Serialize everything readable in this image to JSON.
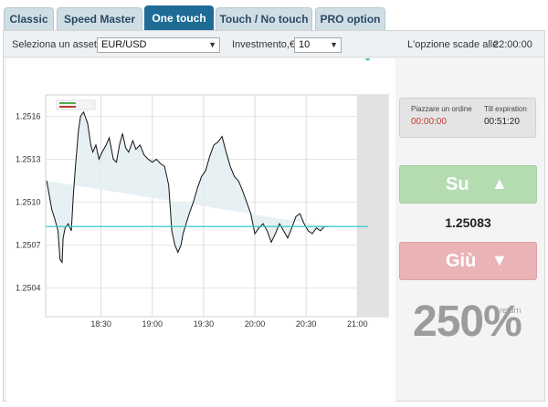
{
  "tabs": [
    {
      "label": "Classic",
      "active": false
    },
    {
      "label": "Speed Master",
      "active": false
    },
    {
      "label": "One touch",
      "active": true
    },
    {
      "label": "Touch / No touch",
      "active": false
    },
    {
      "label": "PRO option",
      "active": false
    }
  ],
  "toolbar": {
    "asset_label": "Seleziona un asset",
    "asset_value": "EUR/USD",
    "investment_label": "Investmento,€",
    "investment_value": "10",
    "expiry_label": "L'opzione scade alle",
    "expiry_time": "22:00:00"
  },
  "order": {
    "place_label": "Piazzare un ordine",
    "place_time": "00:00:00",
    "till_label": "Till expiration",
    "till_time": "00:51:20"
  },
  "buttons": {
    "up_label": "Su",
    "down_label": "Giù"
  },
  "current_price": "1.25083",
  "return_value": "250%",
  "return_label": "return",
  "colors": {
    "active_tab": "#1e6b96",
    "up": "#b5dcb1",
    "down": "#eab4b6",
    "order_time": "#c0392b",
    "price_line": "#3ec7c7",
    "area_fill": "#e3eff2"
  },
  "chart_data": {
    "type": "area",
    "x_ticks": [
      "18:30",
      "19:00",
      "19:30",
      "20:00",
      "20:30",
      "21:00"
    ],
    "y_ticks": [
      "1.2504",
      "1.2507",
      "1.2510",
      "1.2513",
      "1.2516"
    ],
    "ylim": [
      1.2502,
      1.25175
    ],
    "xlim": [
      17.96,
      21.3
    ],
    "grid": true,
    "reference_line": 1.25083,
    "expiry_zone_start": 21.0,
    "x": [
      17.97,
      18.02,
      18.05,
      18.08,
      18.1,
      18.12,
      18.13,
      18.15,
      18.18,
      18.21,
      18.23,
      18.25,
      18.28,
      18.3,
      18.33,
      18.37,
      18.4,
      18.42,
      18.45,
      18.48,
      18.51,
      18.55,
      18.58,
      18.62,
      18.65,
      18.68,
      18.71,
      18.74,
      18.77,
      18.81,
      18.84,
      18.88,
      18.92,
      18.96,
      19.0,
      19.04,
      19.08,
      19.12,
      19.16,
      19.19,
      19.22,
      19.25,
      19.28,
      19.3,
      19.33,
      19.36,
      19.4,
      19.44,
      19.48,
      19.52,
      19.56,
      19.6,
      19.64,
      19.68,
      19.72,
      19.76,
      19.8,
      19.84,
      19.88,
      19.92,
      19.96,
      20.0,
      20.04,
      20.08,
      20.12,
      20.16,
      20.2,
      20.24,
      20.28,
      20.32,
      20.36,
      20.4,
      20.44,
      20.48,
      20.52,
      20.56,
      20.6,
      20.64,
      20.68,
      20.72,
      20.76,
      20.8,
      20.84,
      20.88,
      20.92,
      20.96,
      20.99,
      21.03,
      21.07,
      21.1
    ],
    "y": [
      1.25115,
      1.25095,
      1.25088,
      1.2508,
      1.2506,
      1.25058,
      1.25075,
      1.25082,
      1.25085,
      1.2508,
      1.25105,
      1.25125,
      1.2515,
      1.2516,
      1.25163,
      1.25155,
      1.2514,
      1.25135,
      1.2514,
      1.2513,
      1.25135,
      1.2514,
      1.25145,
      1.2513,
      1.25128,
      1.2514,
      1.25148,
      1.25138,
      1.25135,
      1.25143,
      1.25137,
      1.2514,
      1.25133,
      1.2513,
      1.25128,
      1.2513,
      1.25127,
      1.25125,
      1.25112,
      1.2508,
      1.2507,
      1.25065,
      1.2507,
      1.25078,
      1.25085,
      1.25092,
      1.251,
      1.2511,
      1.25118,
      1.25122,
      1.25132,
      1.2514,
      1.25142,
      1.25146,
      1.25135,
      1.25125,
      1.25118,
      1.25115,
      1.25108,
      1.251,
      1.25092,
      1.25078,
      1.25082,
      1.25085,
      1.2508,
      1.25072,
      1.25078,
      1.25085,
      1.2508,
      1.25075,
      1.25082,
      1.2509,
      1.25092,
      1.25085,
      1.2508,
      1.25078,
      1.25082,
      1.2508,
      1.25083,
      1.25083
    ]
  }
}
